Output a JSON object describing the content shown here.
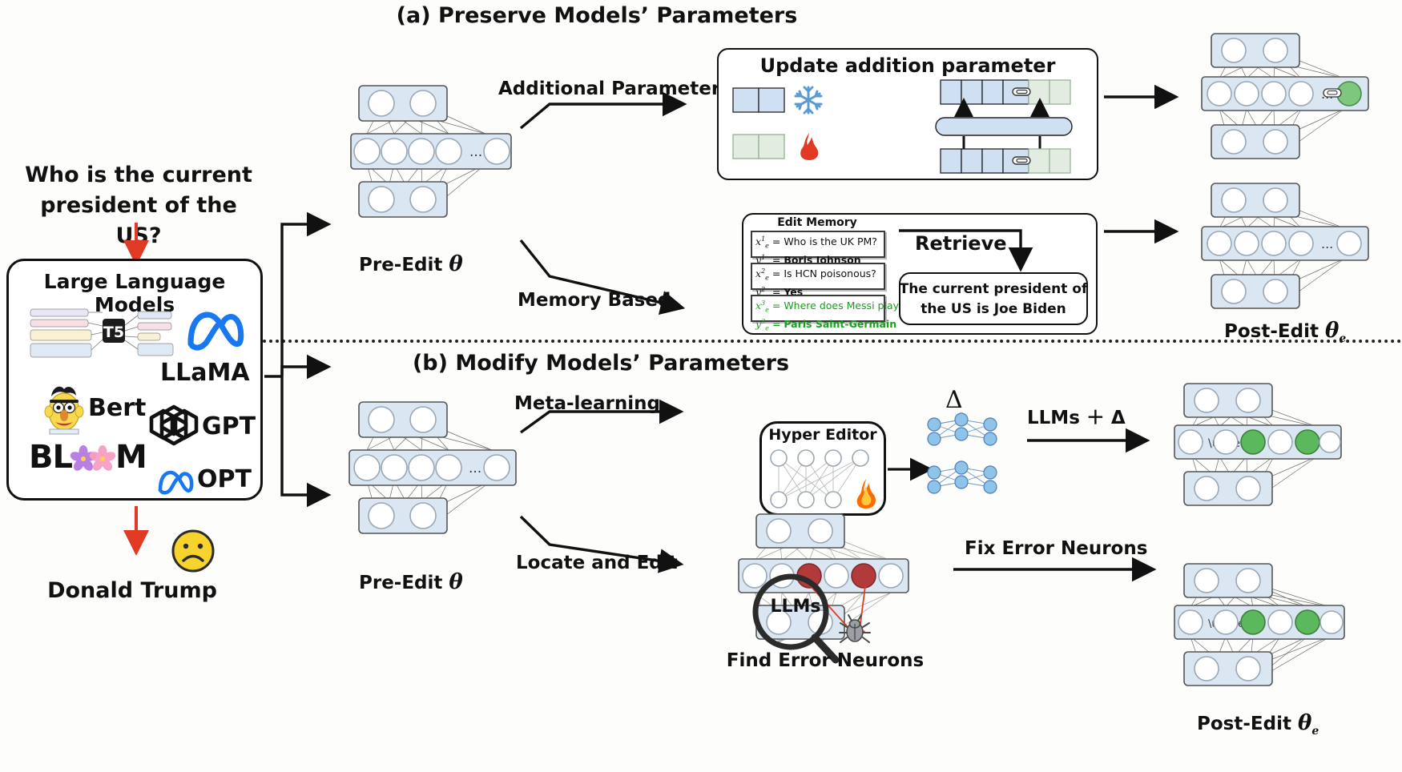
{
  "figure": {
    "section_a_title": "(a) Preserve Models’ Parameters",
    "section_b_title": "(b) Modify Models’ Parameters"
  },
  "input": {
    "question_line1": "Who is the current",
    "question_line2": "president of the US?",
    "llm_box_title": "Large Language Models",
    "models": [
      {
        "name": "T5",
        "icon": "t5-logo"
      },
      {
        "name": "LLaMA",
        "icon": "meta-infinity-logo"
      },
      {
        "name": "Bert",
        "icon": "bert-muppet-icon"
      },
      {
        "name": "GPT",
        "icon": "openai-logo"
      },
      {
        "name": "BLOOM",
        "icon": "bloom-flower-logo"
      },
      {
        "name": "OPT",
        "icon": "meta-infinity-logo"
      }
    ],
    "bloom_prefix": "BL",
    "bloom_suffix": "M",
    "wrong_answer": "Donald Trump",
    "wrong_answer_icon": "frowning-face-emoji"
  },
  "branches": {
    "additional_parameters": "Additional Parameters",
    "memory_based": "Memory Based",
    "meta_learning": "Meta-learning",
    "locate_and_edit": "Locate and Edit"
  },
  "preserve": {
    "pre_edit_label": "Pre-Edit",
    "pre_edit_symbol": "θ",
    "post_edit_label": "Post-Edit",
    "post_edit_symbol": "θ",
    "post_edit_sub": "e",
    "update_box_title": "Update addition parameter",
    "frozen_icon": "snowflake-icon",
    "trainable_icon": "fire-icon",
    "memory": {
      "title": "Edit Memory",
      "entries": [
        {
          "x_label": "x",
          "x_sup": "1",
          "x_sub": "e",
          "x_text": "Who is the UK PM?",
          "y_label": "y",
          "y_sup": "1",
          "y_sub": "e",
          "y_text": "Boris Johnson",
          "highlight": false
        },
        {
          "x_label": "x",
          "x_sup": "2",
          "x_sub": "e",
          "x_text": "Is HCN poisonous?",
          "y_label": "y",
          "y_sup": "2",
          "y_sub": "e",
          "y_text": "Yes",
          "highlight": false
        },
        {
          "x_label": "x",
          "x_sup": "3",
          "x_sub": "e",
          "x_text": "Where does Messi play?",
          "y_label": "y",
          "y_sup": "3",
          "y_sub": "e",
          "y_text": "Paris Saint-Germain",
          "highlight": true
        }
      ]
    },
    "retrieve_label": "Retrieve",
    "retrieved_line1": "The current president of",
    "retrieved_line2": "the US is Joe Biden"
  },
  "modify": {
    "pre_edit_label": "Pre-Edit",
    "pre_edit_symbol": "θ",
    "post_edit_label": "Post-Edit",
    "post_edit_symbol": "θ",
    "post_edit_sub": "e",
    "hyper_editor_title": "Hyper Editor",
    "hyper_editor_icon": "fire-icon",
    "delta_symbol": "Δ",
    "llms_plus_delta": "LLMs ＋ Δ",
    "magnifier_label": "LLMs",
    "find_error_neurons": "Find Error Neurons",
    "fix_error_neurons": "Fix Error Neurons",
    "bug_icon": "bug-icon"
  },
  "colors": {
    "layer_fill": "#dbe6f3",
    "node_stroke": "#9aa7b5",
    "blue_cell": "#cfe0f2",
    "green_cell": "#e3ece0",
    "accent_red": "#e03a24",
    "error_neuron": "#b33a3a",
    "fixed_neuron": "#4caf50",
    "edit_green": "#17a01c",
    "meta_blue": "#1878f0",
    "hyper_node": "#8ec4ea"
  }
}
